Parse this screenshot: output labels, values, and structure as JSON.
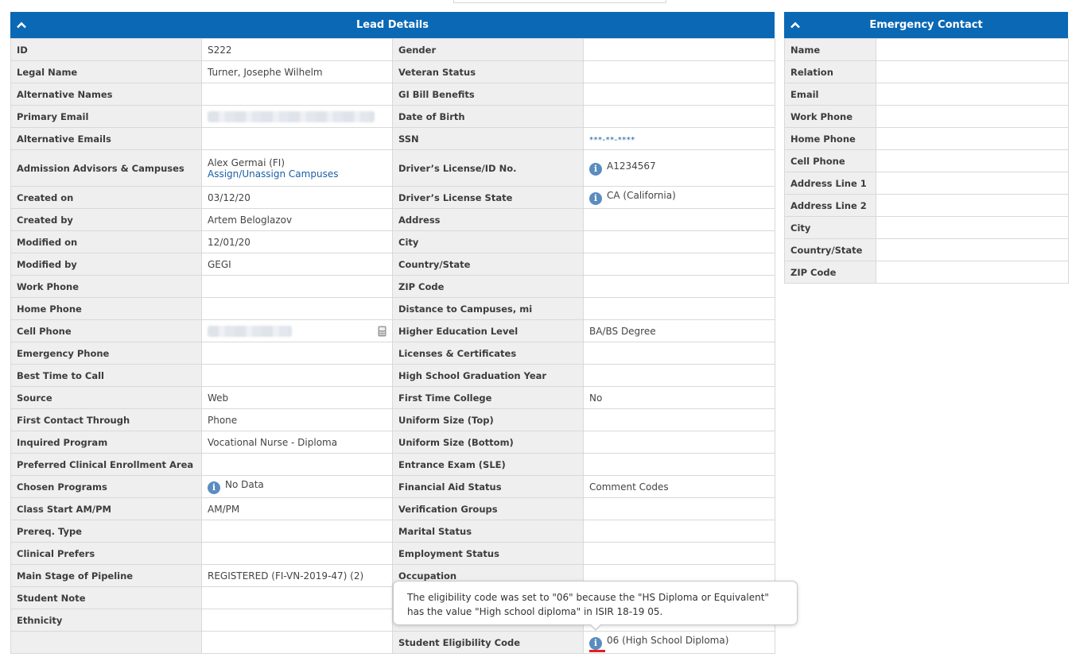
{
  "lead": {
    "title": "Lead Details",
    "rows": [
      {
        "l1": "ID",
        "v1": "S222",
        "l2": "Gender",
        "v2": ""
      },
      {
        "l1": "Legal Name",
        "v1": "Turner, Josephe Wilhelm",
        "l2": "Veteran Status",
        "v2": ""
      },
      {
        "l1": "Alternative Names",
        "v1": "",
        "l2": "GI Bill Benefits",
        "v2": ""
      },
      {
        "l1": "Primary Email",
        "v1": "",
        "l2": "Date of Birth",
        "v2": ""
      },
      {
        "l1": "Alternative Emails",
        "v1": "",
        "l2": "SSN",
        "v2": "***-**-****"
      },
      {
        "l1": "Admission Advisors & Campuses",
        "v1": "Alex Germai (FI)",
        "v1_link": "Assign/Unassign Campuses",
        "l2": "Driver’s License/ID No.",
        "v2": "A1234567"
      },
      {
        "l1": "Created on",
        "v1": "03/12/20",
        "l2": "Driver’s License State",
        "v2": "CA (California)"
      },
      {
        "l1": "Created by",
        "v1": "Artem Beloglazov",
        "l2": "Address",
        "v2": ""
      },
      {
        "l1": "Modified on",
        "v1": "12/01/20",
        "l2": "City",
        "v2": ""
      },
      {
        "l1": "Modified by",
        "v1": "GEGI",
        "l2": "Country/State",
        "v2": ""
      },
      {
        "l1": "Work Phone",
        "v1": "",
        "l2": "ZIP Code",
        "v2": ""
      },
      {
        "l1": "Home Phone",
        "v1": "",
        "l2": "Distance to Campuses, mi",
        "v2": ""
      },
      {
        "l1": "Cell Phone",
        "v1": "",
        "l2": "Higher Education Level",
        "v2": "BA/BS Degree"
      },
      {
        "l1": "Emergency Phone",
        "v1": "",
        "l2": "Licenses & Certificates",
        "v2": ""
      },
      {
        "l1": "Best Time to Call",
        "v1": "",
        "l2": "High School Graduation Year",
        "v2": ""
      },
      {
        "l1": "Source",
        "v1": "Web",
        "l2": "First Time College",
        "v2": "No"
      },
      {
        "l1": "First Contact Through",
        "v1": "Phone",
        "l2": "Uniform Size (Top)",
        "v2": ""
      },
      {
        "l1": "Inquired Program",
        "v1": "Vocational Nurse - Diploma",
        "l2": "Uniform Size (Bottom)",
        "v2": ""
      },
      {
        "l1": "Preferred Clinical Enrollment Area",
        "v1": "",
        "l2": "Entrance Exam (SLE)",
        "v2": ""
      },
      {
        "l1": "Chosen Programs",
        "v1": "No Data",
        "l2": "Financial Aid Status",
        "v2": "Comment Codes"
      },
      {
        "l1": "Class Start AM/PM",
        "v1": "AM/PM",
        "l2": "Verification Groups",
        "v2": ""
      },
      {
        "l1": "Prereq. Type",
        "v1": "",
        "l2": "Marital Status",
        "v2": ""
      },
      {
        "l1": "Clinical Prefers",
        "v1": "",
        "l2": "Employment Status",
        "v2": ""
      },
      {
        "l1": "Main Stage of Pipeline",
        "v1": "REGISTERED (FI-VN-2019-47) (2)",
        "l2": "Occupation",
        "v2": ""
      },
      {
        "l1": "Student Note",
        "v1": "",
        "l2": "",
        "v2": ""
      },
      {
        "l1": "Ethnicity",
        "v1": "",
        "l2": "",
        "v2": ""
      },
      {
        "l1": "",
        "v1": "",
        "l2": "Student Eligibility Code",
        "v2": "06 (High School Diploma)"
      }
    ]
  },
  "emergency": {
    "title": "Emergency Contact",
    "rows": [
      {
        "label": "Name",
        "value": ""
      },
      {
        "label": "Relation",
        "value": ""
      },
      {
        "label": "Email",
        "value": ""
      },
      {
        "label": "Work Phone",
        "value": ""
      },
      {
        "label": "Home Phone",
        "value": ""
      },
      {
        "label": "Cell Phone",
        "value": ""
      },
      {
        "label": "Address Line 1",
        "value": ""
      },
      {
        "label": "Address Line 2",
        "value": ""
      },
      {
        "label": "City",
        "value": ""
      },
      {
        "label": "Country/State",
        "value": ""
      },
      {
        "label": "ZIP Code",
        "value": ""
      }
    ]
  },
  "tooltip": {
    "text": "The eligibility code was set to \"06\" because the \"HS Diploma or Equivalent\" has the value \"High school diploma\" in ISIR 18-19 05."
  },
  "colors": {
    "header": "#0a68b4",
    "label_bg": "#efefef",
    "link": "#1a5fa6",
    "info_icon": "#5b8cc0",
    "highlight": "#e02020"
  },
  "icons": {
    "collapse": "chevron-up-icon",
    "info": "info-icon",
    "phone": "mobile-phone-icon"
  }
}
